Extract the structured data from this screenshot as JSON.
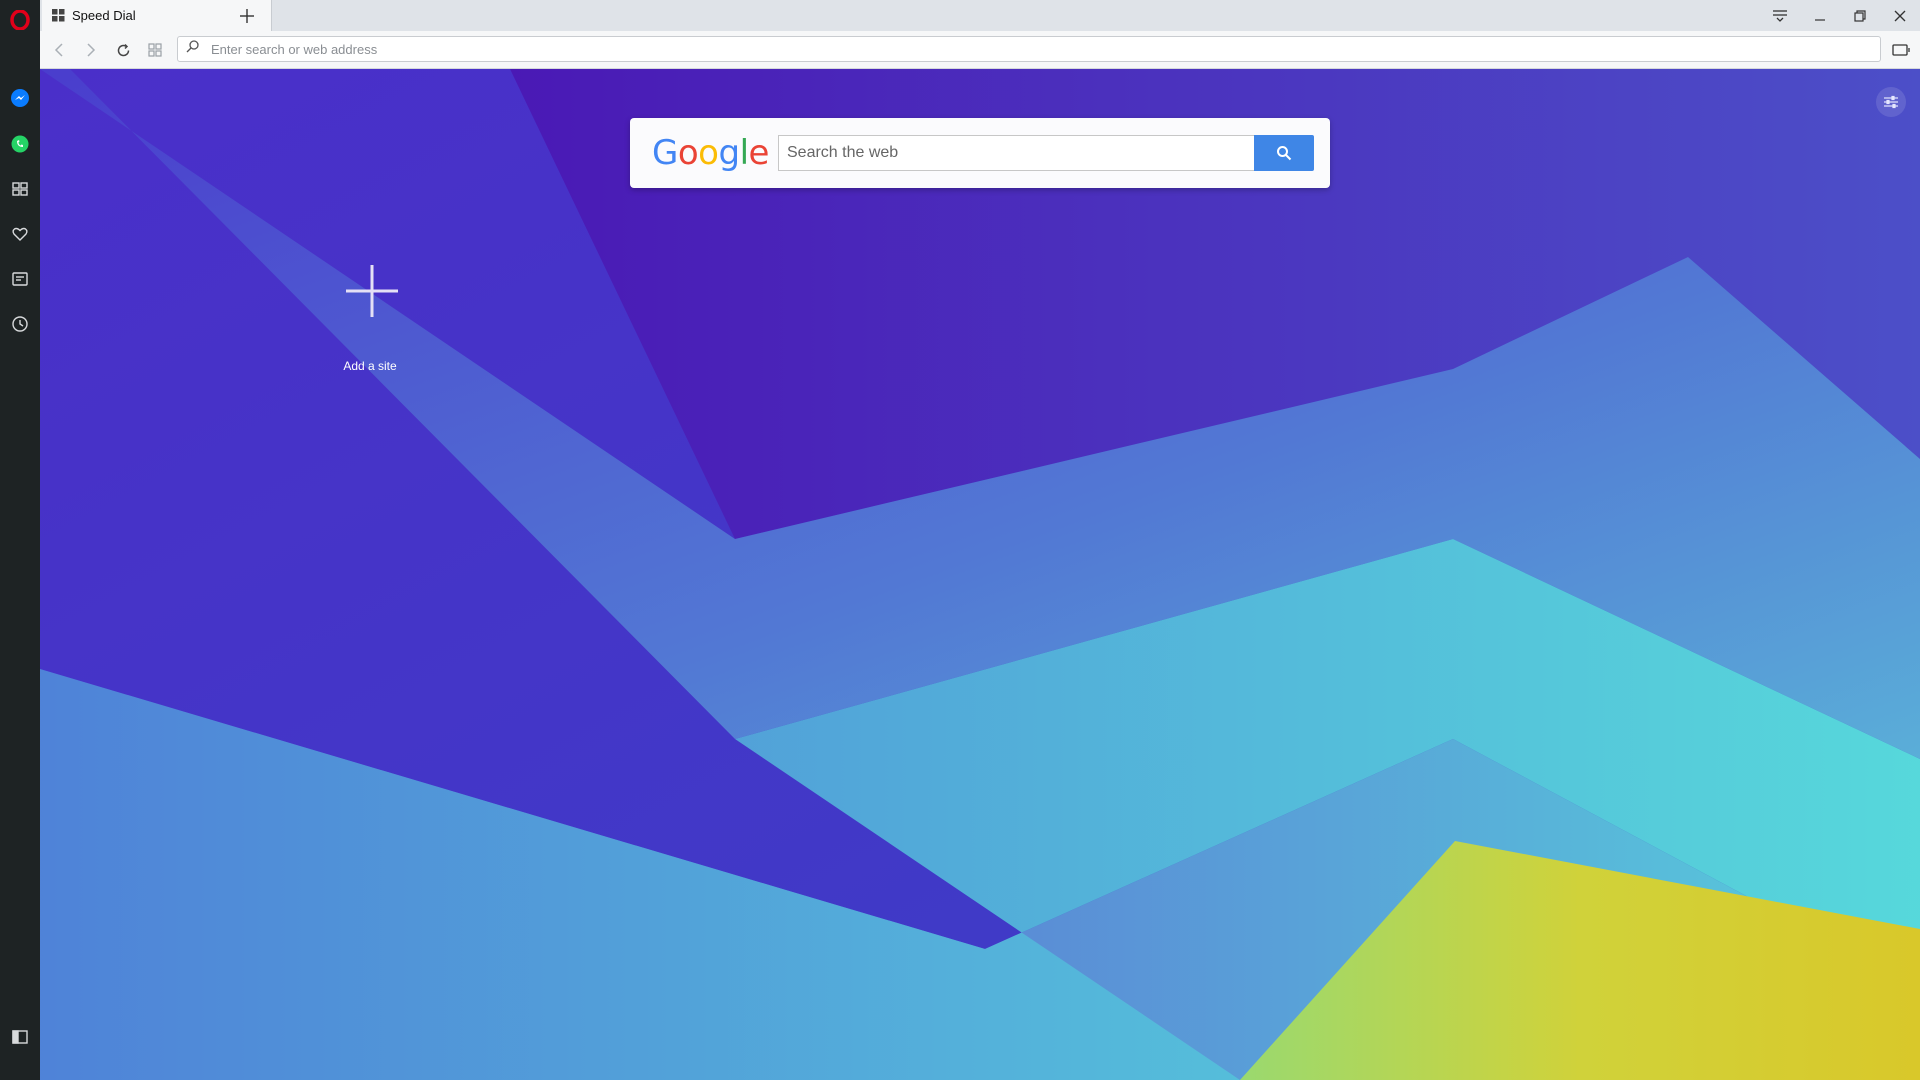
{
  "app": {
    "name": "Opera",
    "brand_color": "#e2001a"
  },
  "sidebar": {
    "items": [
      {
        "name": "messenger",
        "icon": "messenger-icon",
        "color": "#0084ff"
      },
      {
        "name": "whatsapp",
        "icon": "whatsapp-icon",
        "color": "#25d366"
      },
      {
        "name": "speed-dial",
        "icon": "grid-icon"
      },
      {
        "name": "bookmarks",
        "icon": "heart-icon"
      },
      {
        "name": "news",
        "icon": "news-icon"
      },
      {
        "name": "history",
        "icon": "clock-icon"
      }
    ],
    "toggle_icon": "sidebar-toggle-icon"
  },
  "tabs": [
    {
      "label": "Speed Dial",
      "icon": "speed-dial-icon",
      "active": true
    }
  ],
  "window_controls": [
    "tab-menu-icon",
    "minimize-icon",
    "restore-icon",
    "close-icon"
  ],
  "toolbar": {
    "address_placeholder": "Enter search or web address",
    "buttons": [
      "back-icon",
      "forward-icon",
      "reload-icon",
      "speed-dial-icon"
    ]
  },
  "search": {
    "logo_text": "Google",
    "logo_colors": [
      "#4285f4",
      "#ea4335",
      "#fbbc05",
      "#4285f4",
      "#34a853",
      "#ea4335"
    ],
    "placeholder": "Search the web",
    "button_color": "#3f86e6"
  },
  "speed_dial": {
    "add_site_label": "Add a site"
  }
}
